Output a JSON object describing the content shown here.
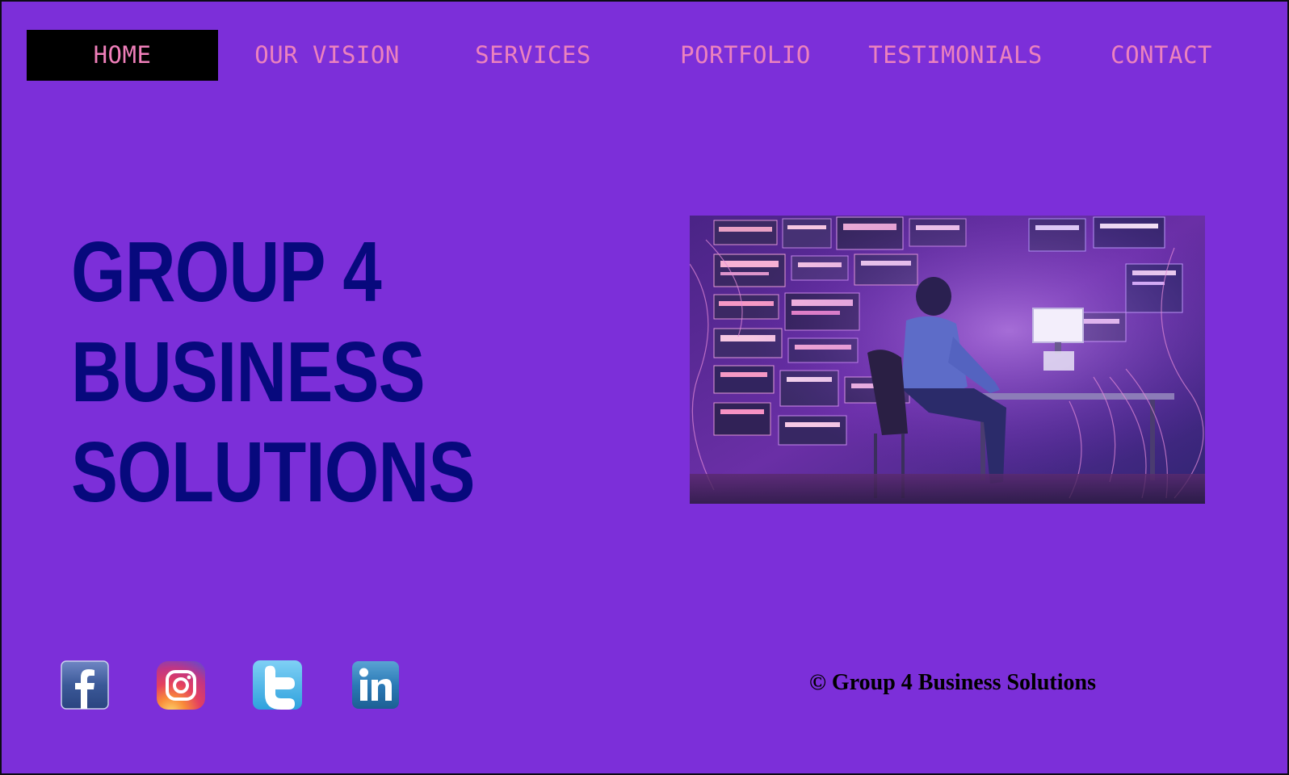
{
  "nav": {
    "items": [
      {
        "label": "HOME",
        "active": true
      },
      {
        "label": "OUR VISION",
        "active": false
      },
      {
        "label": "SERVICES",
        "active": false
      },
      {
        "label": "PORTFOLIO",
        "active": false
      },
      {
        "label": "TESTIMONIALS",
        "active": false
      },
      {
        "label": "CONTACT",
        "active": false
      }
    ]
  },
  "hero": {
    "title_lines": [
      "GROUP 4",
      "BUSINESS",
      "SOLUTIONS"
    ],
    "image_icon": "server-room-photo"
  },
  "social": {
    "links": [
      {
        "icon": "facebook-icon"
      },
      {
        "icon": "instagram-icon"
      },
      {
        "icon": "twitter-icon"
      },
      {
        "icon": "linkedin-icon"
      }
    ]
  },
  "footer": {
    "copyright": "© Group 4 Business Solutions"
  },
  "colors": {
    "background": "#7c2fd9",
    "nav_text": "#ec82be",
    "nav_active_bg": "#000000",
    "title": "#07097d",
    "footer_text": "#000000"
  }
}
